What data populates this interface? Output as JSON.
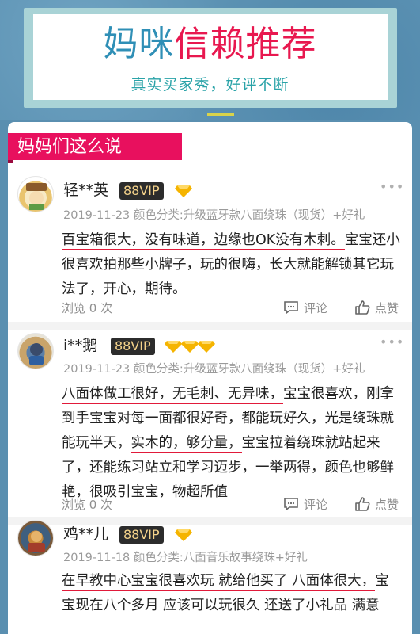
{
  "banner": {
    "title_part1": "妈咪",
    "title_part2": "信赖推荐",
    "subtitle": "真实买家秀，好评不断"
  },
  "section": {
    "title": "妈妈们这么说"
  },
  "reviews": [
    {
      "username": "轻**英",
      "vip": "88VIP",
      "gems": 1,
      "meta": "2019-11-23 颜色分类:升级蓝牙款八面绕珠（现货）+好礼",
      "text_underlined": "百宝箱很大，没有味道，边缘也OK没有木刺。",
      "text_rest": "宝宝还小很喜欢拍那些小牌子，玩的很嗨，长大就能解锁其它玩法了，开心，期待。",
      "views": "浏览 0 次",
      "comment_label": "评论",
      "like_label": "点赞"
    },
    {
      "username": "i**鹅",
      "vip": "88VIP",
      "gems": 3,
      "meta": "2019-11-23 颜色分类:升级蓝牙款八面绕珠（现货）+好礼",
      "seg1_ul": "八面体做工很好，无毛刺、无异味，",
      "seg2": "宝宝很喜欢，刚拿到手宝宝对每一面都很好奇，都能玩好久，光是绕珠就能玩半天，",
      "seg3_ul": "实木的，够分量，",
      "seg4": "宝宝拉着绕珠就站起来了，还能练习站立和学习迈步，一举两得，颜色也够鲜艳，很吸引宝宝，物超所值",
      "views": "浏览 0 次",
      "comment_label": "评论",
      "like_label": "点赞"
    },
    {
      "username": "鸡**儿",
      "vip": "88VIP",
      "gems": 1,
      "meta": "2019-11-18 颜色分类:八面音乐故事绕珠+好礼",
      "text_underlined": "在早教中心宝宝很喜欢玩 就给他买了 八面体很大，",
      "text_rest": "宝宝现在八个多月 应该可以玩很久 还送了小礼品 满意"
    }
  ],
  "colors": {
    "accent_pink": "#e8105e",
    "underline_red": "#e11a3a",
    "vip_bg": "#2c2c2c",
    "vip_text": "#f4d28a",
    "gem": "#f5b400"
  },
  "icons": [
    "more-dots-icon",
    "diamond-icon",
    "comment-icon",
    "thumbs-up-icon"
  ]
}
